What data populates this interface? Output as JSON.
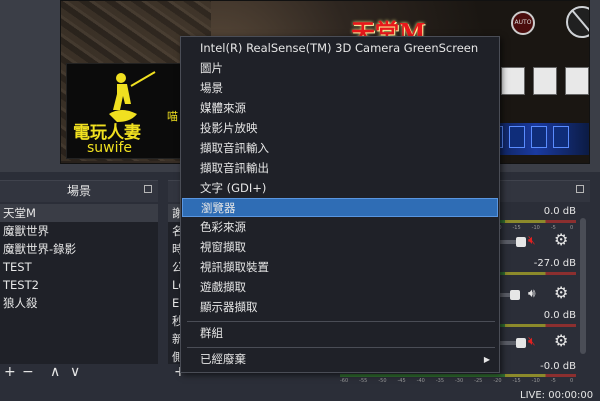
{
  "preview": {
    "game_title": "天堂M",
    "logo_main": "電玩人妻",
    "logo_side": "喵",
    "logo_sub": "suwife",
    "auto_label": "AUTO"
  },
  "scenes": {
    "title": "場景",
    "items": [
      "天堂M",
      "魔獸世界",
      "魔獸世界-錄影",
      "TEST",
      "TEST2",
      "狼人殺"
    ],
    "selected_index": 0,
    "tools": {
      "add": "+",
      "remove": "−",
      "up": "∧",
      "down": "∨"
    }
  },
  "sources": {
    "clipped_items": [
      "謝",
      "名",
      "時",
      "公",
      "Lo",
      "E",
      "秒",
      "新",
      "側"
    ],
    "tools": {
      "add": "+"
    }
  },
  "mixer": {
    "channels": [
      {
        "db": "0.0 dB"
      },
      {
        "db": "-27.0 dB"
      },
      {
        "db": "0.0 dB"
      },
      {
        "db": "-0.0 dB"
      }
    ],
    "ticks": [
      "-60",
      "-55",
      "-50",
      "-45",
      "-40",
      "-35",
      "-30",
      "-25",
      "-20",
      "-15",
      "-10",
      "-5",
      "0"
    ]
  },
  "status": {
    "live": "LIVE: 00:00:00"
  },
  "context_menu": {
    "items": [
      "Intel(R) RealSense(TM) 3D Camera GreenScreen",
      "圖片",
      "場景",
      "媒體來源",
      "投影片放映",
      "擷取音訊輸入",
      "擷取音訊輸出",
      "文字 (GDI+)",
      "瀏覽器",
      "色彩來源",
      "視窗擷取",
      "視訊擷取裝置",
      "遊戲擷取",
      "顯示器擷取"
    ],
    "highlighted_index": 8,
    "group_label": "群組",
    "deprecated_label": "已經廢棄"
  },
  "colors": {
    "background": "#2b2e38",
    "panel": "#1f2128",
    "highlight": "#2f6db5",
    "mute_red": "#e02020"
  }
}
